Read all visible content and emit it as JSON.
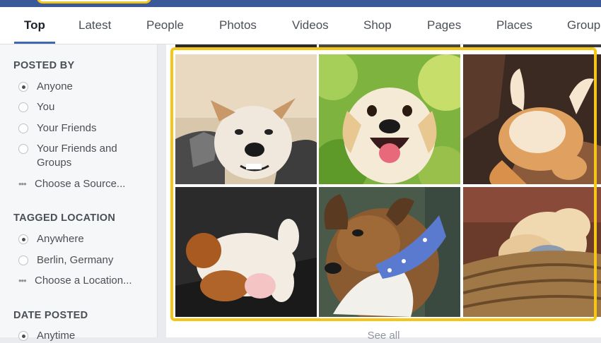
{
  "tabs": [
    "Top",
    "Latest",
    "People",
    "Photos",
    "Videos",
    "Shop",
    "Pages",
    "Places",
    "Group"
  ],
  "sidebar": {
    "posted_by": {
      "title": "POSTED BY",
      "options": [
        "Anyone",
        "You",
        "Your Friends",
        "Your Friends and Groups"
      ],
      "choose": "Choose a Source..."
    },
    "tagged_location": {
      "title": "TAGGED LOCATION",
      "options": [
        "Anywhere",
        "Berlin, Germany"
      ],
      "choose": "Choose a Location..."
    },
    "date_posted": {
      "title": "DATE POSTED",
      "options": [
        "Anytime"
      ]
    }
  },
  "main": {
    "see_all": "See all",
    "photos": [
      "husky puppy photo",
      "yellow labrador puppy photo",
      "sleeping corgi photo",
      "puppy on back photo",
      "sheltie with bandana photo",
      "puppy in basket photo"
    ]
  },
  "colors": {
    "brand": "#3b5998",
    "accent": "#4267b2",
    "highlight": "#f5c518"
  }
}
